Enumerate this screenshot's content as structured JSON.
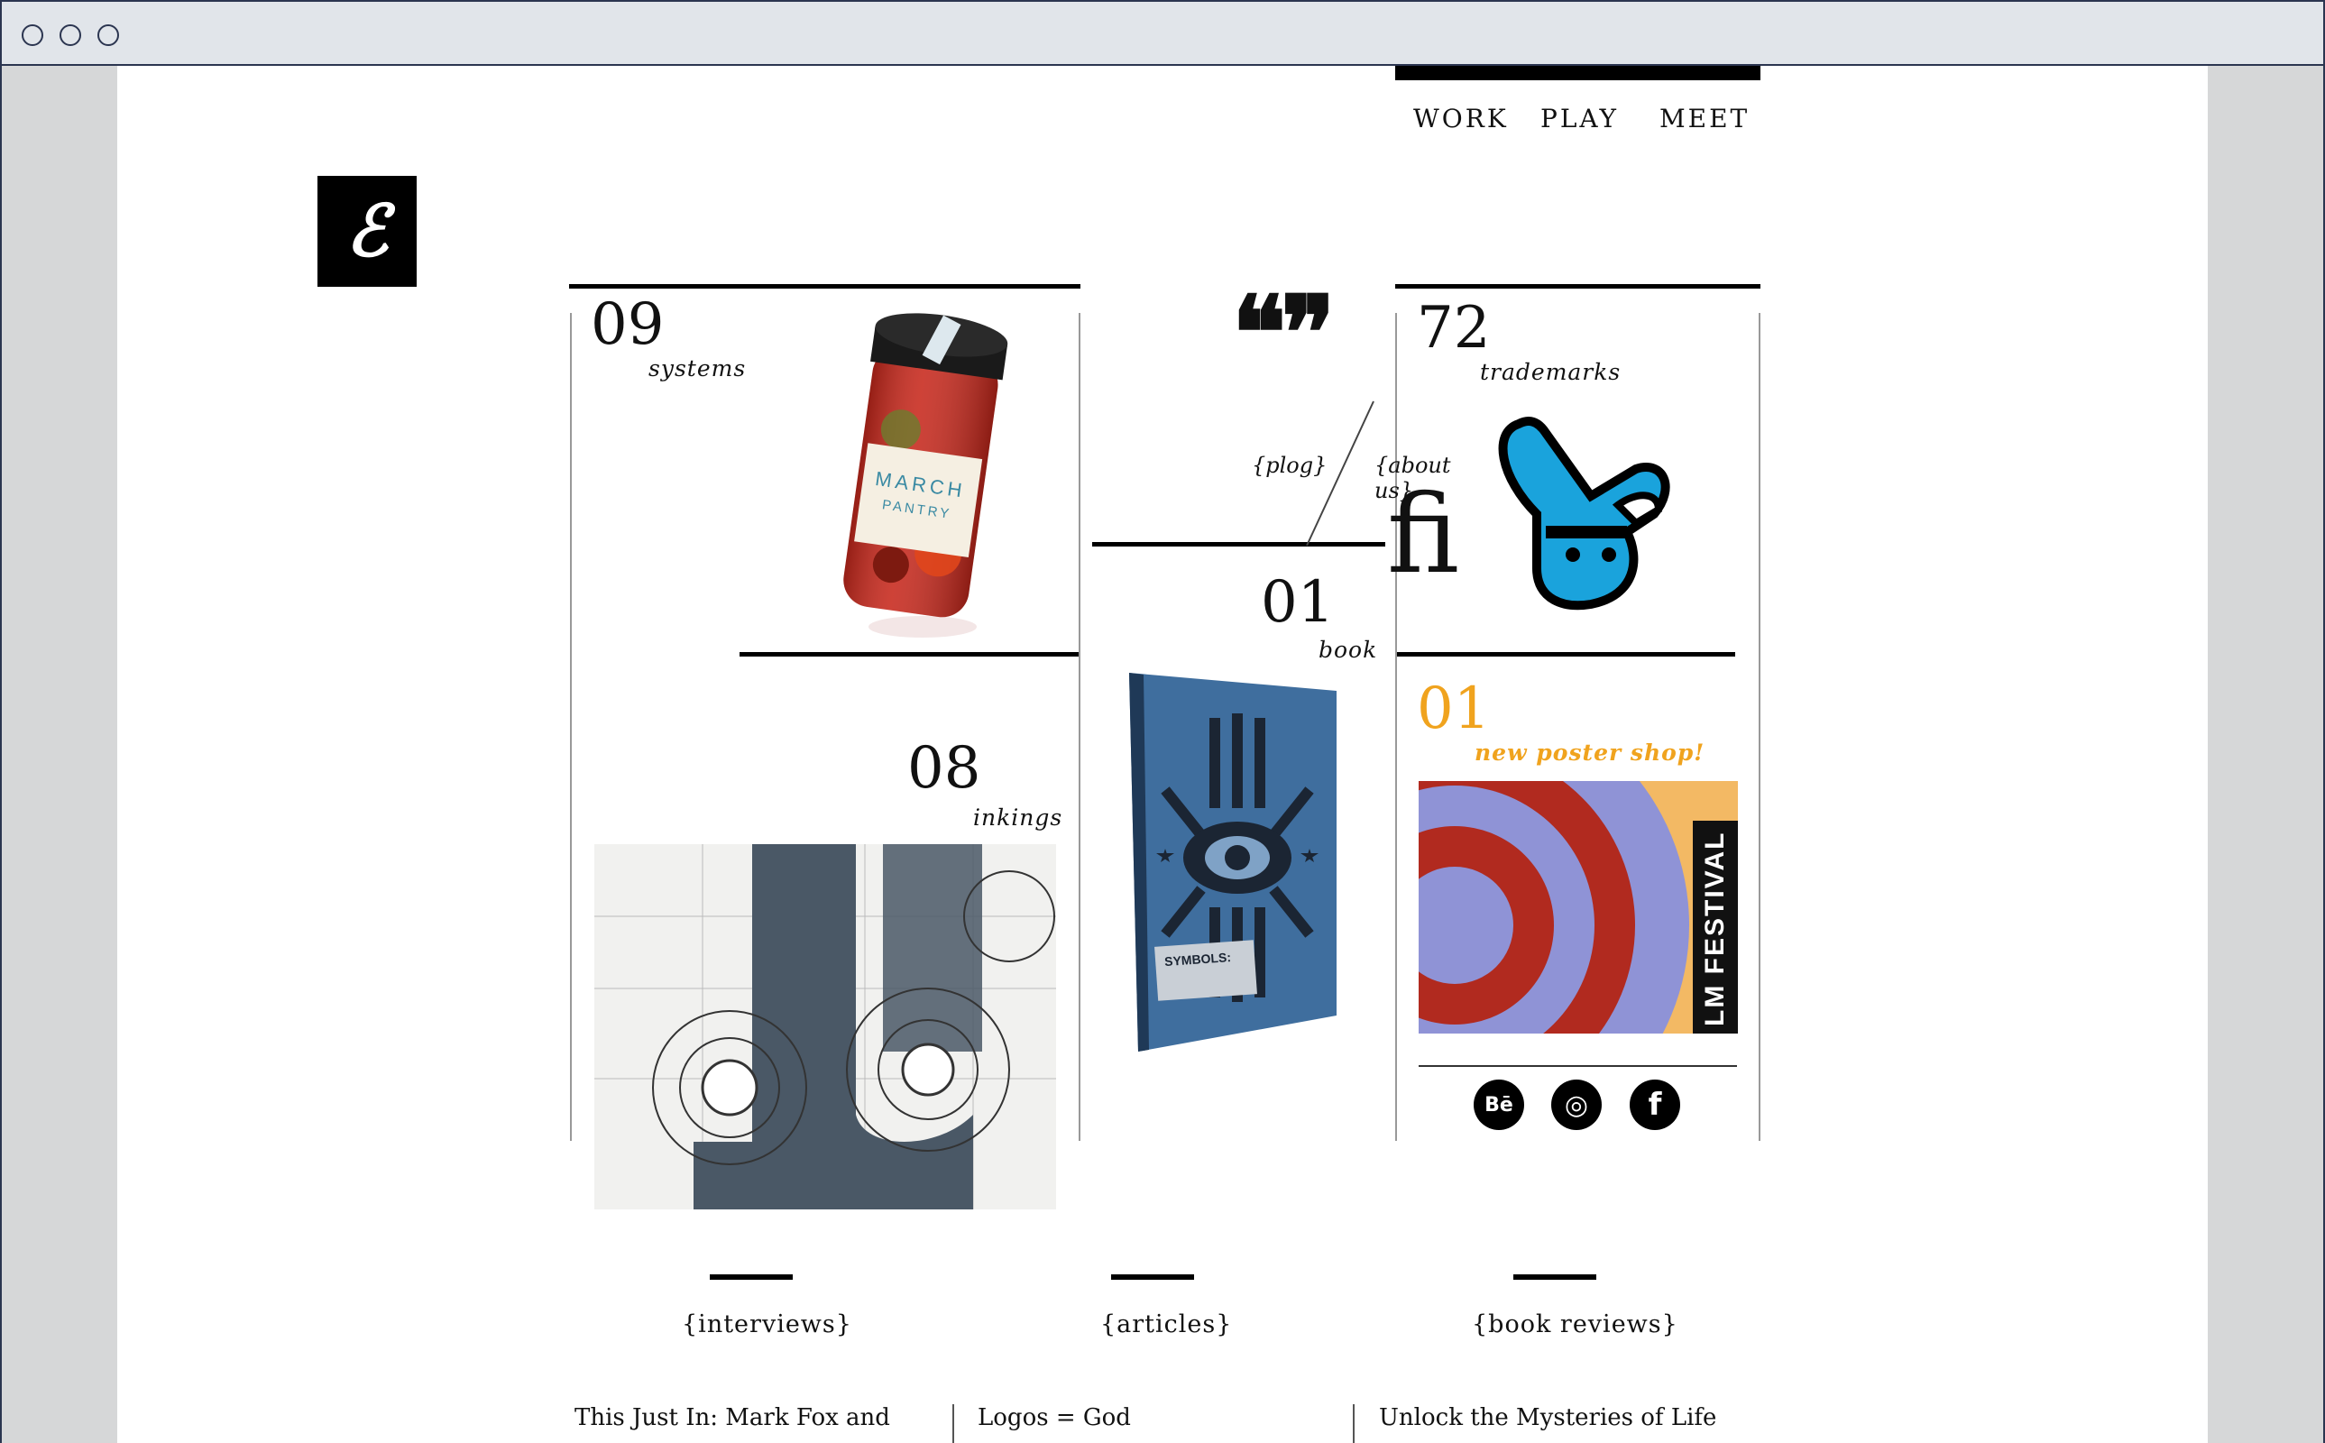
{
  "nav": {
    "work": "WORK",
    "play": "PLAY",
    "meet": "MEET"
  },
  "logo": {
    "icon": "brand-monogram-icon",
    "glyph": "ℰ"
  },
  "tiles": {
    "systems": {
      "number": "09",
      "label": "systems",
      "image": "pickle-jar-photo"
    },
    "quotes": {
      "plog": "{plog}",
      "about": "{about us}",
      "ligature": "ﬁ"
    },
    "trademarks": {
      "number": "72",
      "label": "trademarks",
      "image": "rabbit-mark-icon",
      "accent": "#1aa3dc"
    },
    "inkings": {
      "number": "08",
      "label": "inkings",
      "image": "lettering-sketch"
    },
    "book": {
      "number": "01",
      "label": "book",
      "image": "symbols-book-cover"
    },
    "poster": {
      "number": "01",
      "label": "new poster shop!",
      "accent": "#f0a31e",
      "image": "festival-poster",
      "poster_text": "LM FESTIVAL"
    }
  },
  "social": [
    {
      "icon": "behance-icon",
      "glyph": "Bē"
    },
    {
      "icon": "instagram-icon",
      "glyph": "◎"
    },
    {
      "icon": "facebook-icon",
      "glyph": "f"
    }
  ],
  "footer": {
    "interviews": "{interviews}",
    "articles": "{articles}",
    "book_reviews": "{book reviews}",
    "titles": [
      "This Just In: Mark Fox and",
      "Logos = God",
      "Unlock the Mysteries of Life"
    ]
  }
}
